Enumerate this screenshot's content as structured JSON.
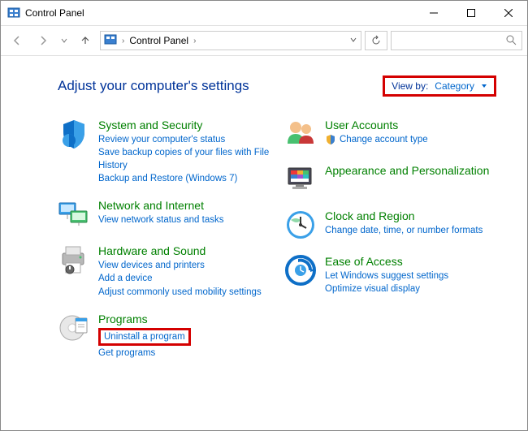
{
  "window": {
    "title": "Control Panel"
  },
  "breadcrumb": {
    "root": "Control Panel"
  },
  "header": {
    "title": "Adjust your computer's settings"
  },
  "viewby": {
    "label": "View by:",
    "value": "Category"
  },
  "left": [
    {
      "title": "System and Security",
      "links": [
        "Review your computer's status",
        "Save backup copies of your files with File History",
        "Backup and Restore (Windows 7)"
      ]
    },
    {
      "title": "Network and Internet",
      "links": [
        "View network status and tasks"
      ]
    },
    {
      "title": "Hardware and Sound",
      "links": [
        "View devices and printers",
        "Add a device",
        "Adjust commonly used mobility settings"
      ]
    },
    {
      "title": "Programs",
      "links": [
        "Uninstall a program",
        "Get programs"
      ]
    }
  ],
  "right": [
    {
      "title": "User Accounts",
      "links": [
        "Change account type"
      ]
    },
    {
      "title": "Appearance and Personalization",
      "links": []
    },
    {
      "title": "Clock and Region",
      "links": [
        "Change date, time, or number formats"
      ]
    },
    {
      "title": "Ease of Access",
      "links": [
        "Let Windows suggest settings",
        "Optimize visual display"
      ]
    }
  ]
}
